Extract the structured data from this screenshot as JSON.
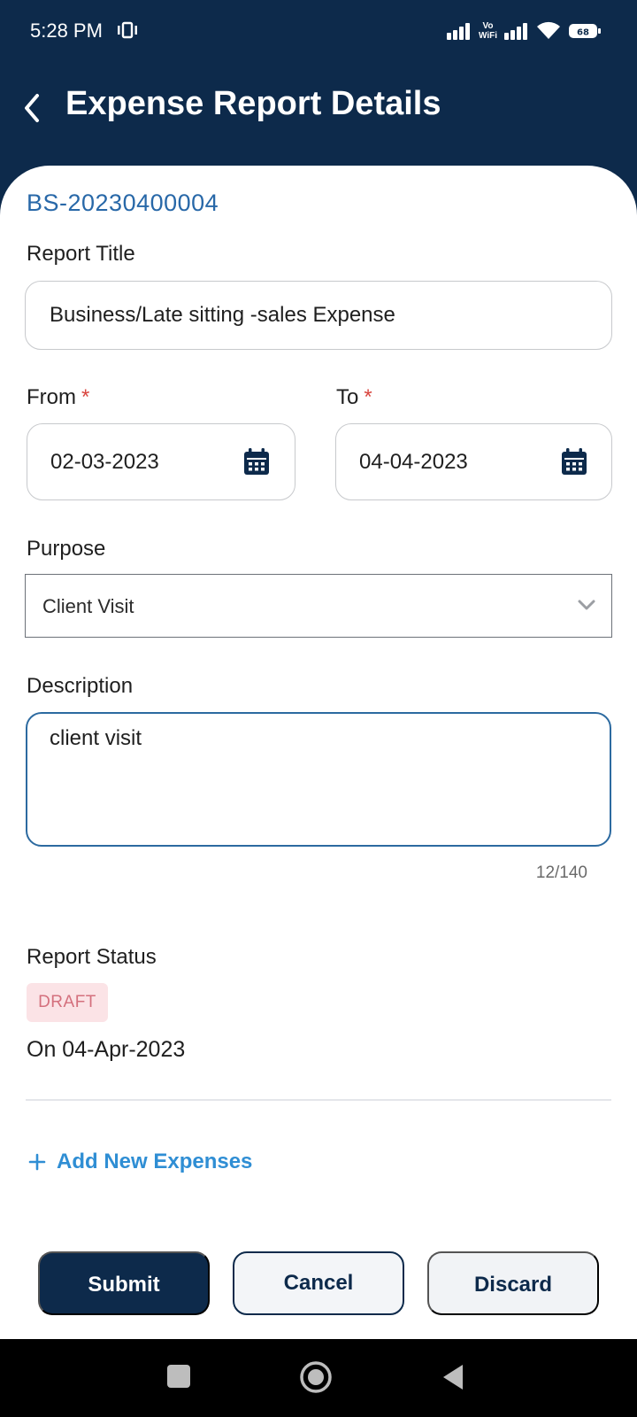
{
  "status_bar": {
    "time": "5:28 PM",
    "vowifi_top": "Vo",
    "vowifi_bottom": "WiFi",
    "battery": "68"
  },
  "header": {
    "title": "Expense Report Details"
  },
  "form": {
    "report_id": "BS-20230400004",
    "report_title_label": "Report Title",
    "report_title_value": "Business/Late sitting -sales Expense",
    "from_label": "From",
    "from_value": "02-03-2023",
    "to_label": "To",
    "to_value": "04-04-2023",
    "required_mark": "*",
    "purpose_label": "Purpose",
    "purpose_value": "Client Visit",
    "description_label": "Description",
    "description_value": "client visit",
    "char_count": "12/140"
  },
  "status": {
    "label": "Report Status",
    "badge": "DRAFT",
    "date": "On 04-Apr-2023"
  },
  "actions": {
    "add_expenses": "Add New Expenses",
    "submit": "Submit",
    "cancel": "Cancel",
    "discard": "Discard"
  },
  "colors": {
    "primary": "#0d2a4b",
    "link": "#2f8ed4",
    "id_text": "#2868a8",
    "required": "#d9463f",
    "draft_bg": "#fbe3e6",
    "draft_text": "#d4707d"
  },
  "icons": {
    "back": "chevron-left",
    "calendar": "calendar",
    "dropdown": "chevron-down",
    "add": "plus"
  }
}
